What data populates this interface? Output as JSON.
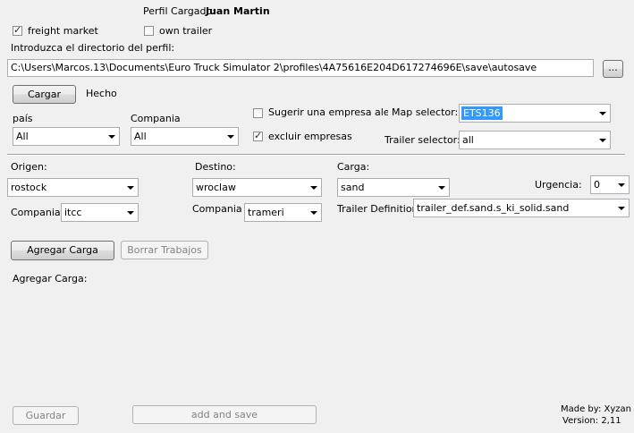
{
  "profile": {
    "label": "Perfil Cargado:",
    "name": "Juan Martin"
  },
  "options": {
    "freight_market": {
      "label": "freight market",
      "checked": true
    },
    "own_trailer": {
      "label": "own trailer",
      "checked": false
    }
  },
  "directory": {
    "label": "Introduzca el directorio del perfil:",
    "path": "C:\\Users\\Marcos.13\\Documents\\Euro Truck Simulator 2\\profiles\\4A75616E204D617274696E\\save\\autosave",
    "browse_label": "..."
  },
  "load": {
    "button_label": "Cargar",
    "status": "Hecho"
  },
  "filters": {
    "pais_label": "país",
    "pais_value": "All",
    "compania_label": "Compania",
    "compania_value": "All",
    "suggest": {
      "label": "Sugerir una empresa aleatoria",
      "checked": false
    },
    "exclude": {
      "label": "excluir empresas",
      "checked": true
    },
    "map_selector_label": "Map selector:",
    "map_selector_value": "ETS136",
    "trailer_selector_label": "Trailer selector:",
    "trailer_selector_value": "all"
  },
  "job": {
    "origen_label": "Origen:",
    "origen_value": "rostock",
    "origen_compania_label": "Compania",
    "origen_compania_value": "itcc",
    "destino_label": "Destino:",
    "destino_value": "wroclaw",
    "destino_compania_label": "Compania",
    "destino_compania_value": "trameri",
    "carga_label": "Carga:",
    "carga_value": "sand",
    "urgencia_label": "Urgencia:",
    "urgencia_value": "0",
    "trailer_def_label": "Trailer Definition",
    "trailer_def_value": "trailer_def.sand.s_ki_solid.sand"
  },
  "actions": {
    "add_label": "Agregar Carga",
    "delete_label": "Borrar Trabajos",
    "list_label": "Agregar Carga:",
    "save_label": "Guardar",
    "add_save_label": "add and save"
  },
  "footer": {
    "made_by": "Made by: Xyzan",
    "version": "Version: 2,11"
  }
}
